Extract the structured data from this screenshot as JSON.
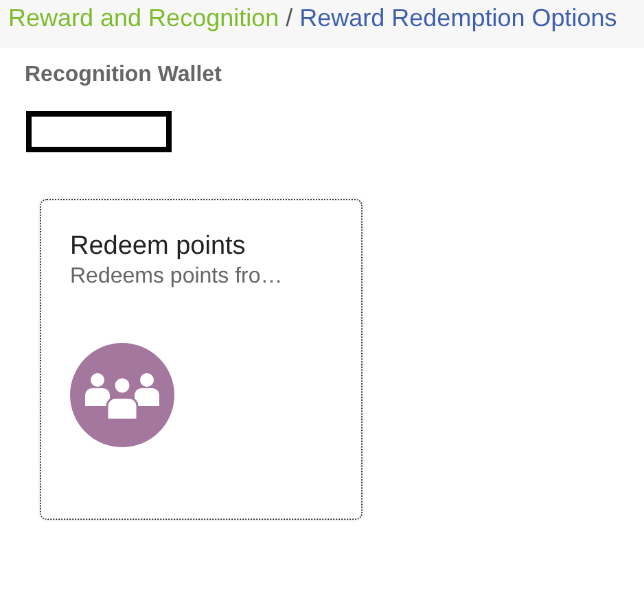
{
  "breadcrumb": [
    {
      "label": "Reward and Recognition",
      "current": false
    },
    {
      "separator": "/"
    },
    {
      "label": "Reward Redemption Options",
      "current": true
    }
  ],
  "section": {
    "title": "Recognition Wallet"
  },
  "tiles": [
    {
      "title": "Redeem points",
      "subtitle": "Redeems points fro…",
      "focused": true
    }
  ]
}
